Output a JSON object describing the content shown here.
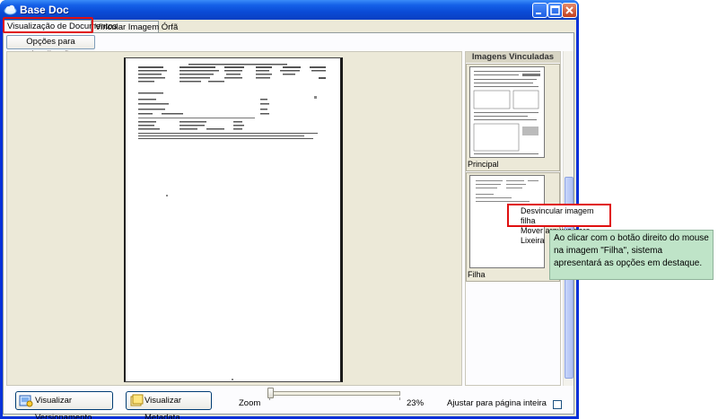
{
  "window": {
    "title": "Base Doc"
  },
  "tabs": [
    {
      "label": "Visualização de Documentos",
      "active": true
    },
    {
      "label": "Vincular Imagem Órfã",
      "active": false
    }
  ],
  "toolbar": {
    "options_label": "Opções para visualização"
  },
  "side_panel": {
    "header": "Imagens Vinculadas",
    "thumbnails": [
      {
        "label": "Principal"
      },
      {
        "label": "Filha"
      }
    ]
  },
  "context_menu": {
    "items": [
      "Desvincular imagem filha",
      "Mover arquivo para Lixeira"
    ]
  },
  "bottom": {
    "versioning_label": "Visualizar Versionamento",
    "metadata_label": "Visualizar Metadata",
    "zoom_label": "Zoom",
    "zoom_value": "23%",
    "fit_label": "Ajustar para página inteira",
    "fit_checked": false
  },
  "annotation": {
    "text": "Ao clicar com o botão direito do mouse na imagem \"Filha\", sistema apresentará as opções em destaque."
  },
  "colors": {
    "highlight": "#e01010",
    "callout_bg": "#bfe4c8",
    "titlebar": "#0a4bd6"
  }
}
